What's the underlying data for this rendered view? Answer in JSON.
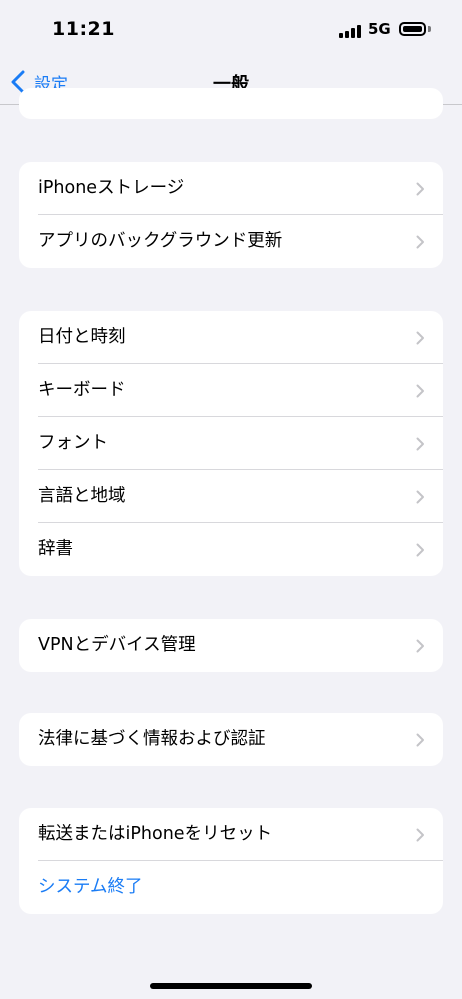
{
  "status_bar": {
    "time": "11:21",
    "network": "5G",
    "battery_percent": 100
  },
  "nav": {
    "back_label": "設定",
    "title": "一般"
  },
  "groups": [
    {
      "rows": [
        {
          "label": "iPhoneストレージ"
        },
        {
          "label": "アプリのバックグラウンド更新"
        }
      ]
    },
    {
      "rows": [
        {
          "label": "日付と時刻"
        },
        {
          "label": "キーボード"
        },
        {
          "label": "フォント"
        },
        {
          "label": "言語と地域"
        },
        {
          "label": "辞書"
        }
      ]
    },
    {
      "rows": [
        {
          "label": "VPNとデバイス管理"
        }
      ]
    },
    {
      "rows": [
        {
          "label": "法律に基づく情報および認証"
        }
      ]
    },
    {
      "rows": [
        {
          "label": "転送またはiPhoneをリセット"
        },
        {
          "label": "システム終了"
        }
      ]
    }
  ],
  "colors": {
    "accent": "#1a7cf5",
    "background": "#f2f2f7",
    "chevron": "#c4c4c8"
  },
  "icons": {
    "back": "chevron-left-icon",
    "disclosure": "chevron-right-icon"
  }
}
